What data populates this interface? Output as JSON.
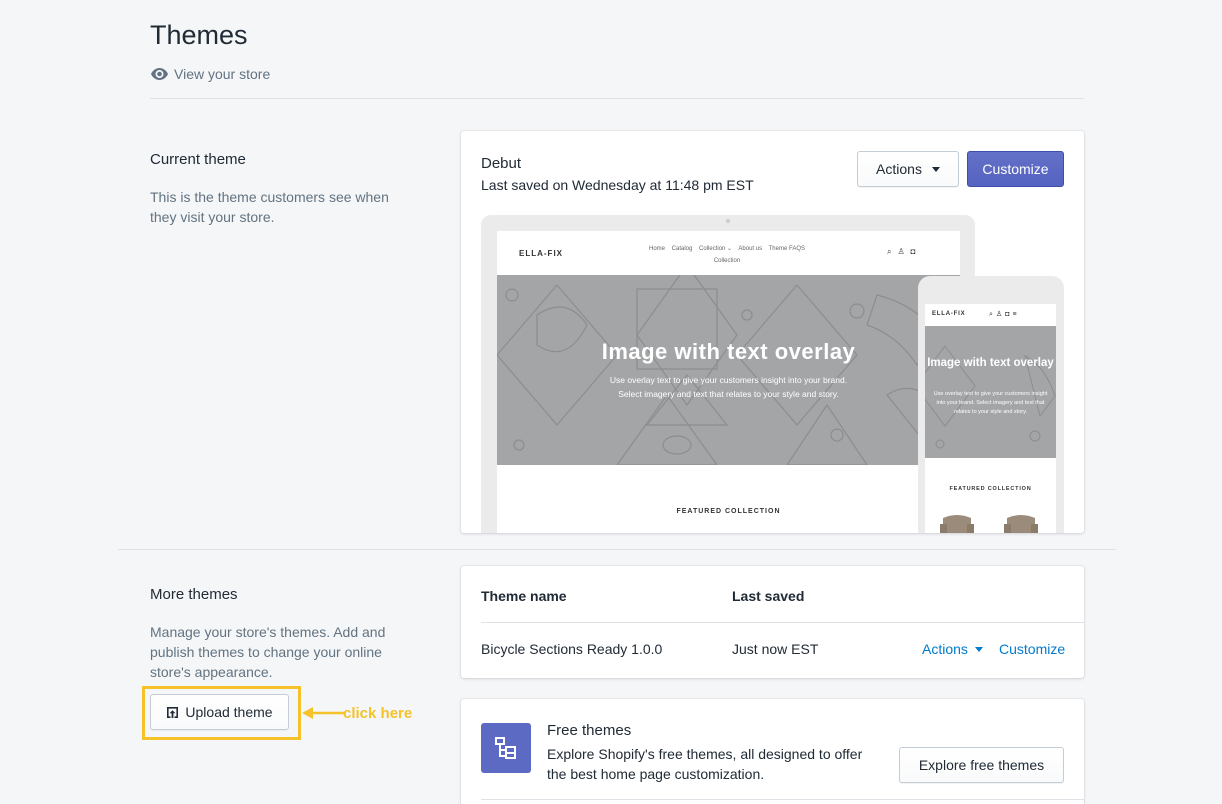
{
  "header": {
    "title": "Themes",
    "view_store": "View your store"
  },
  "current_theme": {
    "section_title": "Current theme",
    "section_desc": "This is the theme customers see when they visit your store.",
    "name": "Debut",
    "saved": "Last saved on Wednesday at 11:48 pm EST",
    "actions_label": "Actions",
    "customize_label": "Customize",
    "preview": {
      "logo": "ELLA-FIX",
      "nav_line1": "Home    Catalog    Collection ⌄    About us    Theme FAQS",
      "nav_line2": "Collection",
      "hero_title": "Image with text overlay",
      "hero_text_1": "Use overlay text to give your customers insight into your brand.",
      "hero_text_2": "Select imagery and text that relates to your style and story.",
      "featured": "FEATURED COLLECTION",
      "mobile_logo": "ELLA-FIX",
      "mobile_hero_title": "Image with text overlay",
      "mobile_hero_text": "Use overlay text to give your customers insight into your brand. Select imagery and text that relates to your style and story.",
      "mobile_featured": "FEATURED COLLECTION"
    }
  },
  "more_themes": {
    "section_title": "More themes",
    "section_desc": "Manage your store's themes. Add and publish themes to change your online store's appearance.",
    "upload_label": "Upload theme",
    "annotation": "click here",
    "table": {
      "col_name": "Theme name",
      "col_saved": "Last saved",
      "rows": [
        {
          "name": "Bicycle Sections Ready 1.0.0",
          "saved": "Just now EST",
          "actions": "Actions",
          "customize": "Customize"
        }
      ]
    },
    "free": {
      "title": "Free themes",
      "desc": "Explore Shopify's free themes, all designed to offer the best home page customization.",
      "button": "Explore free themes"
    }
  },
  "colors": {
    "primary": "#5c6ac4",
    "link": "#007ace",
    "highlight": "#f5c22a"
  }
}
